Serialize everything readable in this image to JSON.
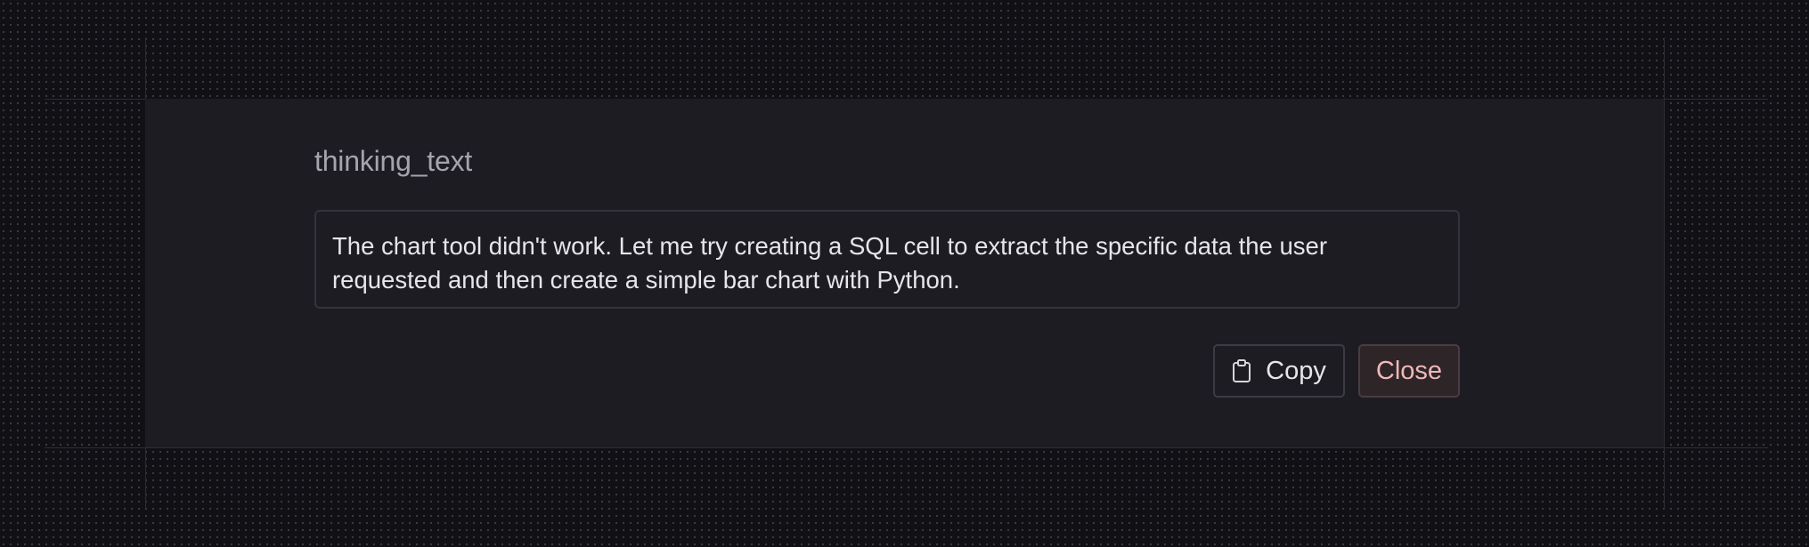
{
  "dialog": {
    "title": "thinking_text",
    "content": "The chart tool didn't work. Let me try creating a SQL cell to extract the specific data the user requested and then create a simple bar chart with Python.",
    "copy_label": "Copy",
    "copy_icon": "clipboard-icon",
    "close_label": "Close"
  },
  "colors": {
    "page_background": "#111015",
    "panel_background": "#1d1c23",
    "close_text": "#f0b8b8",
    "close_background": "#2e2528"
  }
}
